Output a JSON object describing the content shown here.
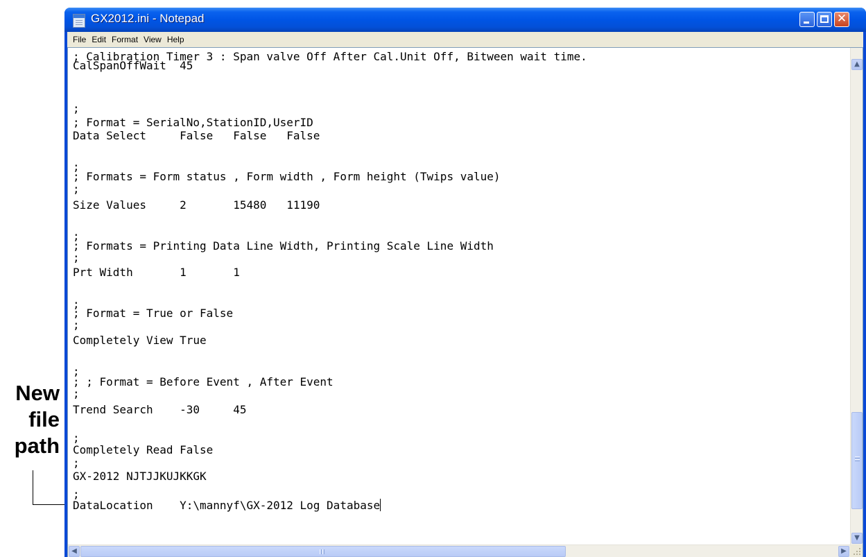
{
  "annotation": {
    "lines": [
      "New",
      "file",
      "path"
    ]
  },
  "window": {
    "title": "GX2012.ini - Notepad",
    "controls": {
      "minimize": "minimize",
      "maximize": "maximize",
      "close": "close"
    }
  },
  "menu": [
    "File",
    "Edit",
    "Format",
    "View",
    "Help"
  ],
  "editor": {
    "lines": [
      "; Calibration Timer 3 : Span valve Off After Cal.Unit Off, Bitween wait time.",
      "CalSpanOffWait  45",
      ";",
      "; Format = SerialNo,StationID,UserID",
      "Data Select     False   False   False",
      ";",
      "; Formats = Form status , Form width , Form height (Twips value)",
      ";",
      "Size Values     2       15480   11190",
      ";",
      "; Formats = Printing Data Line Width, Printing Scale Line Width",
      ";",
      "Prt Width       1       1",
      ";",
      "; Format = True or False",
      ";",
      "Completely View True",
      ";",
      "; ; Format = Before Event , After Event",
      ";",
      "Trend Search    -30     45",
      ";",
      "Completely Read False",
      ";",
      "GX-2012 NJTJJKUJKKGK",
      ";",
      "DataLocation    Y:\\mannyf\\GX-2012 Log Database"
    ]
  },
  "icons": {
    "app": "notepad-icon",
    "scroll_up": "arrow-up-icon",
    "scroll_down": "arrow-down-icon",
    "scroll_left": "arrow-left-icon",
    "scroll_right": "arrow-right-icon"
  },
  "colors": {
    "titlebar": "#0055e5",
    "menubar": "#ece9d8",
    "scrollbar_thumb": "#c1d3fb"
  }
}
